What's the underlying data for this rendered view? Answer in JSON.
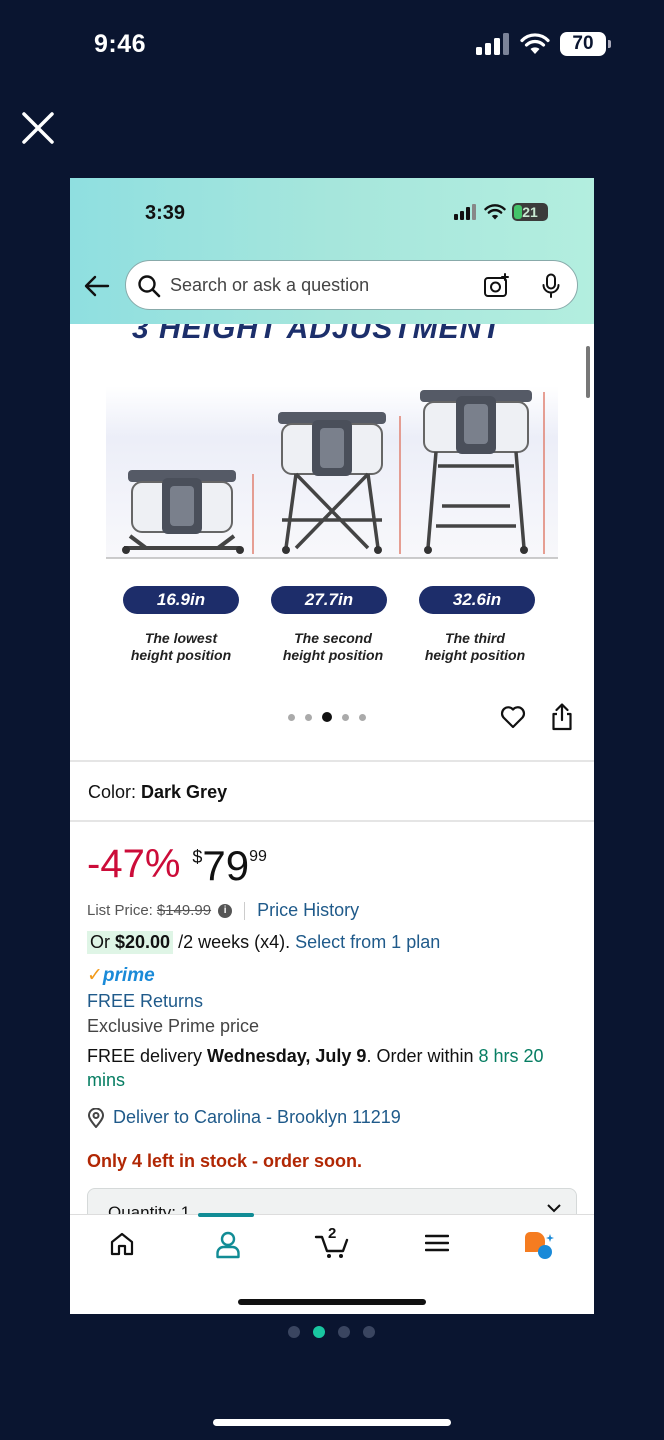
{
  "outer_status": {
    "time": "9:46",
    "battery": "70"
  },
  "viewer": {
    "close_icon": "close-icon"
  },
  "inner_status": {
    "time": "3:39",
    "battery": "21"
  },
  "search": {
    "placeholder": "Search or ask a question"
  },
  "product": {
    "banner": "3 HEIGHT ADJUSTMENT",
    "heights": [
      {
        "value": "16.9in",
        "caption_line1": "The lowest",
        "caption_line2": "height position"
      },
      {
        "value": "27.7in",
        "caption_line1": "The second",
        "caption_line2": "height position"
      },
      {
        "value": "32.6in",
        "caption_line1": "The third",
        "caption_line2": "height position"
      }
    ],
    "image_dots_total": 5,
    "image_dots_active": 3,
    "color_label": "Color:",
    "color_value": "Dark Grey"
  },
  "pricing": {
    "discount": "-47%",
    "currency": "$",
    "price_whole": "79",
    "price_cents": "99",
    "list_price_label": "List Price:",
    "list_price": "$149.99",
    "price_history": "Price History",
    "plan_prefix": "Or",
    "plan_amount": "$20.00",
    "plan_terms": "/2 weeks (x4).",
    "plan_link": "Select from 1 plan",
    "prime": "prime",
    "free_returns": "FREE Returns",
    "exclusive": "Exclusive Prime price",
    "delivery_prefix": "FREE delivery",
    "delivery_date": "Wednesday, July 9",
    "delivery_mid": ". Order within",
    "delivery_time": "8 hrs 20 mins",
    "deliver_to": "Deliver to Carolina - Brooklyn 11219",
    "stock": "Only 4 left in stock - order soon.",
    "quantity": "Quantity: 1"
  },
  "tabbar": {
    "cart_count": "2",
    "active_tab": "account"
  },
  "page_dots": {
    "total": 4,
    "active": 2
  },
  "colors": {
    "accent_teal": "#118c95",
    "discount_red": "#cc0c39",
    "link_blue": "#1f5a8a",
    "stock_red": "#b12704",
    "prime_blue": "#1a8ad8"
  }
}
